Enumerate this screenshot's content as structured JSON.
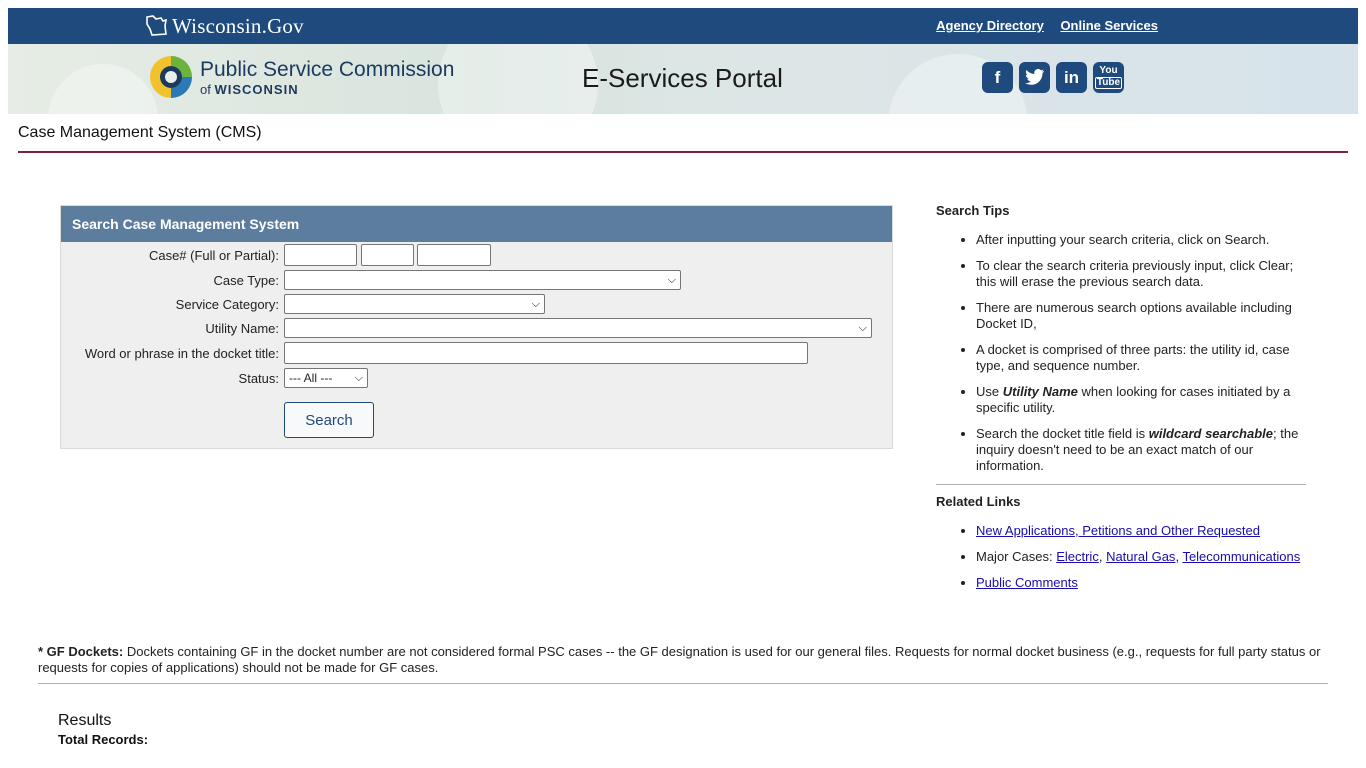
{
  "topbar": {
    "logo_text": "Wisconsin.Gov",
    "links": [
      "Agency Directory",
      "Online Services"
    ]
  },
  "banner": {
    "psc_line1": "Public Service Commission",
    "psc_of": "of",
    "psc_wisconsin": "WISCONSIN",
    "portal_title": "E-Services Portal",
    "social": [
      "facebook-icon",
      "twitter-icon",
      "linkedin-icon",
      "youtube-icon"
    ]
  },
  "page": {
    "heading": "Case Management System (CMS)"
  },
  "search": {
    "panel_title": "Search Case Management System",
    "case_label": "Case# (Full or Partial):",
    "case_type_label": "Case Type:",
    "service_category_label": "Service Category:",
    "utility_name_label": "Utility Name:",
    "phrase_label": "Word or phrase in the docket title:",
    "status_label": "Status:",
    "status_value": "--- All ---",
    "search_button": "Search"
  },
  "sidebar": {
    "tips_title": "Search Tips",
    "tips": [
      "After inputting your search criteria, click on Search.",
      "To clear the search criteria previously input, click Clear; this will erase the previous search data.",
      "There are numerous search options available including Docket ID,",
      "A docket is comprised of three parts: the utility id, case type, and sequence number.",
      "when looking for cases initiated by a specific utility.",
      "; the inquiry doesn't need to be an exact match of our information."
    ],
    "tip5_prefix": "Use",
    "tip5_bold": "Utility Name",
    "tip6_prefix": "Search the docket title field is",
    "tip6_bold": "wildcard searchable",
    "related_title": "Related Links",
    "link_new_apps": "New Applications, Petitions and Other Requested",
    "major_prefix": "Major Cases:",
    "link_electric": "Electric",
    "link_gas": "Natural Gas",
    "link_telecom": "Telecommunications",
    "link_public_comments": "Public Comments"
  },
  "gf_note": {
    "bold": "* GF Dockets:",
    "text": " Dockets containing GF in the docket number are not considered formal PSC cases -- the GF designation is used for our general files. Requests for normal docket business (e.g., requests for full party status or requests for copies of applications) should not be made for GF cases."
  },
  "results": {
    "title": "Results",
    "total_label": "Total Records:"
  },
  "colors": {
    "brand_blue": "#1e4a7e",
    "panel_header": "#5d7d9e",
    "rule": "#7a1f3d"
  }
}
